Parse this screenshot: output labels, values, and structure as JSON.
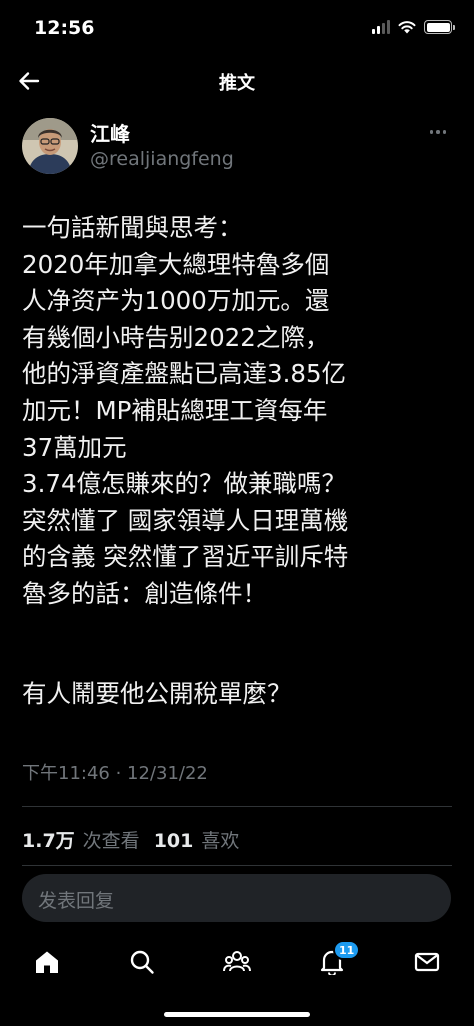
{
  "status_bar": {
    "time": "12:56"
  },
  "header": {
    "title": "推文"
  },
  "tweet": {
    "author_name": "江峰",
    "author_handle": "@realjiangfeng",
    "lines": [
      "一句話新聞與思考：",
      "2020年加拿大總理特魯多個",
      "人净资产为1000万加元。還",
      "有幾個小時告别2022之際，",
      "他的淨資產盤點已高達3.85亿",
      "加元！MP補貼總理工資每年",
      "37萬加元",
      "3.74億怎賺來的？做兼職嗎？",
      "突然懂了 國家領導人日理萬機",
      "的含義 突然懂了習近平訓斥特",
      "魯多的話：創造條件！"
    ],
    "extra_line": "有人鬧要他公開稅單麼？",
    "timestamp": "下午11:46 · 12/31/22"
  },
  "stats": {
    "views_count": "1.7万",
    "views_label": "次查看",
    "likes_count": "101",
    "likes_label": "喜欢"
  },
  "reply": {
    "placeholder": "发表回复"
  },
  "bottom_nav": {
    "notifications_badge": "11"
  },
  "colors": {
    "background": "#000000",
    "text_primary": "#e7e9ea",
    "text_secondary": "#71767b",
    "accent": "#1d9bf0",
    "divider": "#2f3336",
    "input_bg": "#202327"
  },
  "icons": {
    "back": "arrow-left-icon",
    "more": "more-horizontal-icon",
    "nav": [
      "home-icon",
      "search-icon",
      "communities-icon",
      "bell-icon",
      "mail-icon"
    ]
  }
}
